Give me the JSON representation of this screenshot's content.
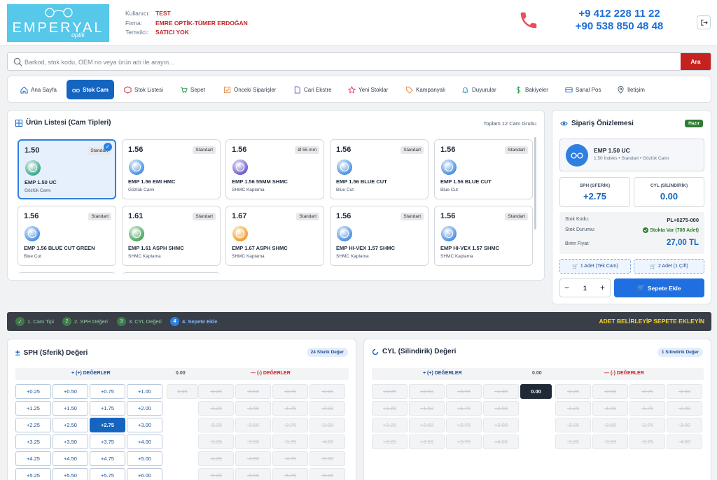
{
  "header": {
    "logo_text": "EMPERYAL",
    "logo_sub": "optik",
    "user_label": "Kullanıcı:",
    "user_value": "TEST",
    "firm_label": "Firma:",
    "firm_value": "EMRE OPTİK-TÜMER ERDOĞAN",
    "rep_label": "Temsilci:",
    "rep_value": "SATICI YOK",
    "phone1": "+9 412 228 11 22",
    "phone2": "+90 538 850 48 48"
  },
  "search": {
    "placeholder": "Barkod, stok kodu, OEM no veya ürün adı ile arayın...",
    "button": "Ara"
  },
  "nav": [
    {
      "label": "Ana Sayfa",
      "icon": "home-icon"
    },
    {
      "label": "Stok Cam",
      "icon": "glasses-icon",
      "active": true
    },
    {
      "label": "Stok Listesi",
      "icon": "box-icon"
    },
    {
      "label": "Sepet",
      "icon": "cart-icon"
    },
    {
      "label": "Önceki Siparişler",
      "icon": "checklist-icon"
    },
    {
      "label": "Cari Ekstre",
      "icon": "document-icon"
    },
    {
      "label": "Yeni Stoklar",
      "icon": "star-icon"
    },
    {
      "label": "Kampanyalı",
      "icon": "tag-icon"
    },
    {
      "label": "Duyurular",
      "icon": "bell-icon"
    },
    {
      "label": "Bakiyeler",
      "icon": "dollar-icon"
    },
    {
      "label": "Sanal Pos",
      "icon": "credit-card-icon"
    },
    {
      "label": "İletişim",
      "icon": "location-icon"
    }
  ],
  "products": {
    "title": "Ürün Listesi (Cam Tipleri)",
    "total": "Toplam 12 Cam Grubu",
    "cards": [
      {
        "index": "1.50",
        "tag": "Standart",
        "name": "EMP 1.50 UC",
        "sub": "Gözlük Camı",
        "color": "#3aa88a",
        "selected": true
      },
      {
        "index": "1.56",
        "tag": "Standart",
        "name": "EMP 1.56 EMI HMC",
        "sub": "Gözlük Camı",
        "color": "#4a90e2"
      },
      {
        "index": "1.56",
        "tag": "Ø 55 mm",
        "name": "EMP 1.56 55MM SHMC",
        "sub": "SHMC Kaplama",
        "color": "#6a5ccf"
      },
      {
        "index": "1.56",
        "tag": "Standart",
        "name": "EMP 1.56 BLUE CUT",
        "sub": "Blue Cut",
        "color": "#4a90e2"
      },
      {
        "index": "1.56",
        "tag": "Standart",
        "name": "EMP 1.56 BLUE CUT",
        "sub": "Blue Cut",
        "color": "#4a90e2"
      },
      {
        "index": "1.56",
        "tag": "Standart",
        "name": "EMP 1.56 BLUE CUT GREEN",
        "sub": "Blue Cut",
        "color": "#4a90e2"
      },
      {
        "index": "1.61",
        "tag": "Standart",
        "name": "EMP 1.61 ASPH SHMC",
        "sub": "SHMC Kaplama",
        "color": "#46a85a"
      },
      {
        "index": "1.67",
        "tag": "Standart",
        "name": "EMP 1.67 ASPH SHMC",
        "sub": "SHMC Kaplama",
        "color": "#f0a030"
      },
      {
        "index": "1.56",
        "tag": "Standart",
        "name": "EMP HI-VEX 1.57 SHMC",
        "sub": "SHMC Kaplama",
        "color": "#4a90e2"
      },
      {
        "index": "1.56",
        "tag": "Standart",
        "name": "EMP HI-VEX 1.57 SHMC",
        "sub": "SHMC Kaplama",
        "color": "#4a90e2"
      }
    ]
  },
  "preview": {
    "title": "Sipariş Önizlemesi",
    "status": "Hazır",
    "product_name": "EMP 1.50 UC",
    "product_desc": "1.50 İndeks • Standart • Gözlük Camı",
    "sph_label": "SPH (SFERİK)",
    "sph_value": "+2.75",
    "cyl_label": "CYL (SİLİNDİRİK)",
    "cyl_value": "0.00",
    "stock_code_label": "Stok Kodu:",
    "stock_code": "PL+0275-000",
    "stock_status_label": "Stok Durumu:",
    "stock_status": "Stokta Var (708 Adet)",
    "price_label": "Birim Fiyat:",
    "price": "27,00 TL",
    "single_btn": "1 Adet (Tek Cam)",
    "pair_btn": "2 Adet (1 Çift)",
    "quantity": "1",
    "add_btn": "Sepete Ekle"
  },
  "steps": {
    "items": [
      {
        "n": "✓",
        "label": "1. Cam Tipi"
      },
      {
        "n": "2",
        "label": "2. SPH Değeri"
      },
      {
        "n": "3",
        "label": "3. CYL Değeri"
      },
      {
        "n": "4",
        "label": "4. Sepete Ekle",
        "current": true
      }
    ],
    "warning": "ADET BELİRLEYİP SEPETE EKLEYİN"
  },
  "sph": {
    "title": "SPH (Sferik) Değeri",
    "badge": "24 Sferik Değer",
    "plus_header": "+ (+) DEĞERLER",
    "zero_header": "0.00",
    "minus_header": "— (-) DEĞERLER",
    "plus_values": [
      "+0.25",
      "+0.50",
      "+0.75",
      "+1.00",
      "+1.25",
      "+1.50",
      "+1.75",
      "+2.00",
      "+2.25",
      "+2.50",
      "+2.75",
      "+3.00",
      "+3.25",
      "+3.50",
      "+3.75",
      "+4.00",
      "+4.25",
      "+4.50",
      "+4.75",
      "+5.00",
      "+5.25",
      "+5.50",
      "+5.75",
      "+6.00"
    ],
    "zero_value": "0.00",
    "minus_values": [
      "-0.25",
      "-0.50",
      "-0.75",
      "-1.00",
      "-1.25",
      "-1.50",
      "-1.75",
      "-2.00",
      "-2.25",
      "-2.50",
      "-2.75",
      "-3.00",
      "-3.25",
      "-3.50",
      "-3.75",
      "-4.00",
      "-4.25",
      "-4.50",
      "-4.75",
      "-5.00",
      "-5.25",
      "-5.50",
      "-5.75",
      "-6.00"
    ],
    "selected": "+2.75"
  },
  "cyl": {
    "title": "CYL (Silindirik) Değeri",
    "badge": "1 Silindirik Değer",
    "plus_header": "+ (+) DEĞERLER",
    "zero_header": "0.00",
    "minus_header": "— (-) DEĞERLER",
    "plus_values": [
      "+0.25",
      "+0.50",
      "+0.75",
      "+1.00",
      "+1.25",
      "+1.50",
      "+1.75",
      "+2.00",
      "+2.25",
      "+2.50",
      "+2.75",
      "+3.00",
      "+3.25",
      "+3.50",
      "+3.75",
      "+4.00"
    ],
    "zero_value": "0.00",
    "minus_values": [
      "-0.25",
      "-0.50",
      "-0.75",
      "-1.00",
      "-1.25",
      "-1.50",
      "-1.75",
      "-2.00",
      "-2.25",
      "-2.50",
      "-2.75",
      "-3.00",
      "-3.25",
      "-3.50",
      "-3.75",
      "-4.00"
    ],
    "selected": "0.00"
  }
}
